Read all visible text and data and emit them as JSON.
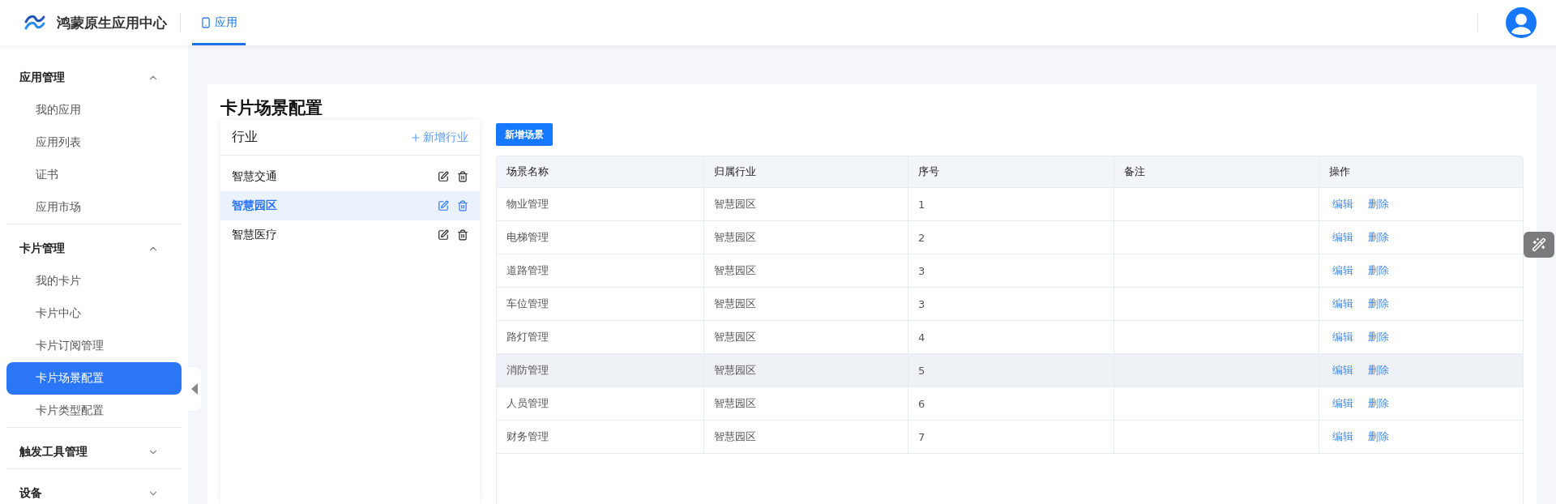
{
  "header": {
    "app_name": "鸿蒙原生应用中心",
    "nav_tabs": [
      {
        "label": "应用",
        "selected": true
      }
    ]
  },
  "sidebar": {
    "groups": [
      {
        "title": "应用管理",
        "expanded": true,
        "items": [
          {
            "label": "我的应用",
            "selected": false
          },
          {
            "label": "应用列表",
            "selected": false
          },
          {
            "label": "证书",
            "selected": false
          },
          {
            "label": "应用市场",
            "selected": false
          }
        ]
      },
      {
        "title": "卡片管理",
        "expanded": true,
        "items": [
          {
            "label": "我的卡片",
            "selected": false
          },
          {
            "label": "卡片中心",
            "selected": false
          },
          {
            "label": "卡片订阅管理",
            "selected": false
          },
          {
            "label": "卡片场景配置",
            "selected": true
          },
          {
            "label": "卡片类型配置",
            "selected": false
          }
        ]
      },
      {
        "title": "触发工具管理",
        "expanded": false
      },
      {
        "title": "设备",
        "expanded": false
      }
    ]
  },
  "page": {
    "title": "卡片场景配置",
    "industry_panel": {
      "title": "行业",
      "add_label": "新增行业",
      "items": [
        {
          "label": "智慧交通",
          "selected": false
        },
        {
          "label": "智慧园区",
          "selected": true
        },
        {
          "label": "智慧医疗",
          "selected": false
        }
      ]
    },
    "add_scene_button": "新增场景",
    "table": {
      "columns": [
        "场景名称",
        "归属行业",
        "序号",
        "备注",
        "操作"
      ],
      "rows": [
        {
          "name": "物业管理",
          "industry": "智慧园区",
          "order": "1",
          "highlighted": false,
          "actions": [
            "编辑",
            "删除"
          ]
        },
        {
          "name": "电梯管理",
          "industry": "智慧园区",
          "order": "2",
          "highlighted": false,
          "actions": [
            "编辑",
            "删除"
          ]
        },
        {
          "name": "道路管理",
          "industry": "智慧园区",
          "order": "3",
          "highlighted": false,
          "actions": [
            "编辑",
            "删除"
          ]
        },
        {
          "name": "车位管理",
          "industry": "智慧园区",
          "order": "3",
          "highlighted": false,
          "actions": [
            "编辑",
            "删除"
          ]
        },
        {
          "name": "路灯管理",
          "industry": "智慧园区",
          "order": "4",
          "highlighted": false,
          "actions": [
            "编辑",
            "删除"
          ]
        },
        {
          "name": "消防管理",
          "industry": "智慧园区",
          "order": "5",
          "highlighted": true,
          "actions": [
            "编辑",
            "删除"
          ]
        },
        {
          "name": "人员管理",
          "industry": "智慧园区",
          "order": "6",
          "highlighted": false,
          "actions": [
            "编辑",
            "删除"
          ]
        },
        {
          "name": "财务管理",
          "industry": "智慧园区",
          "order": "7",
          "highlighted": false,
          "actions": [
            "编辑",
            "删除"
          ]
        }
      ]
    }
  }
}
